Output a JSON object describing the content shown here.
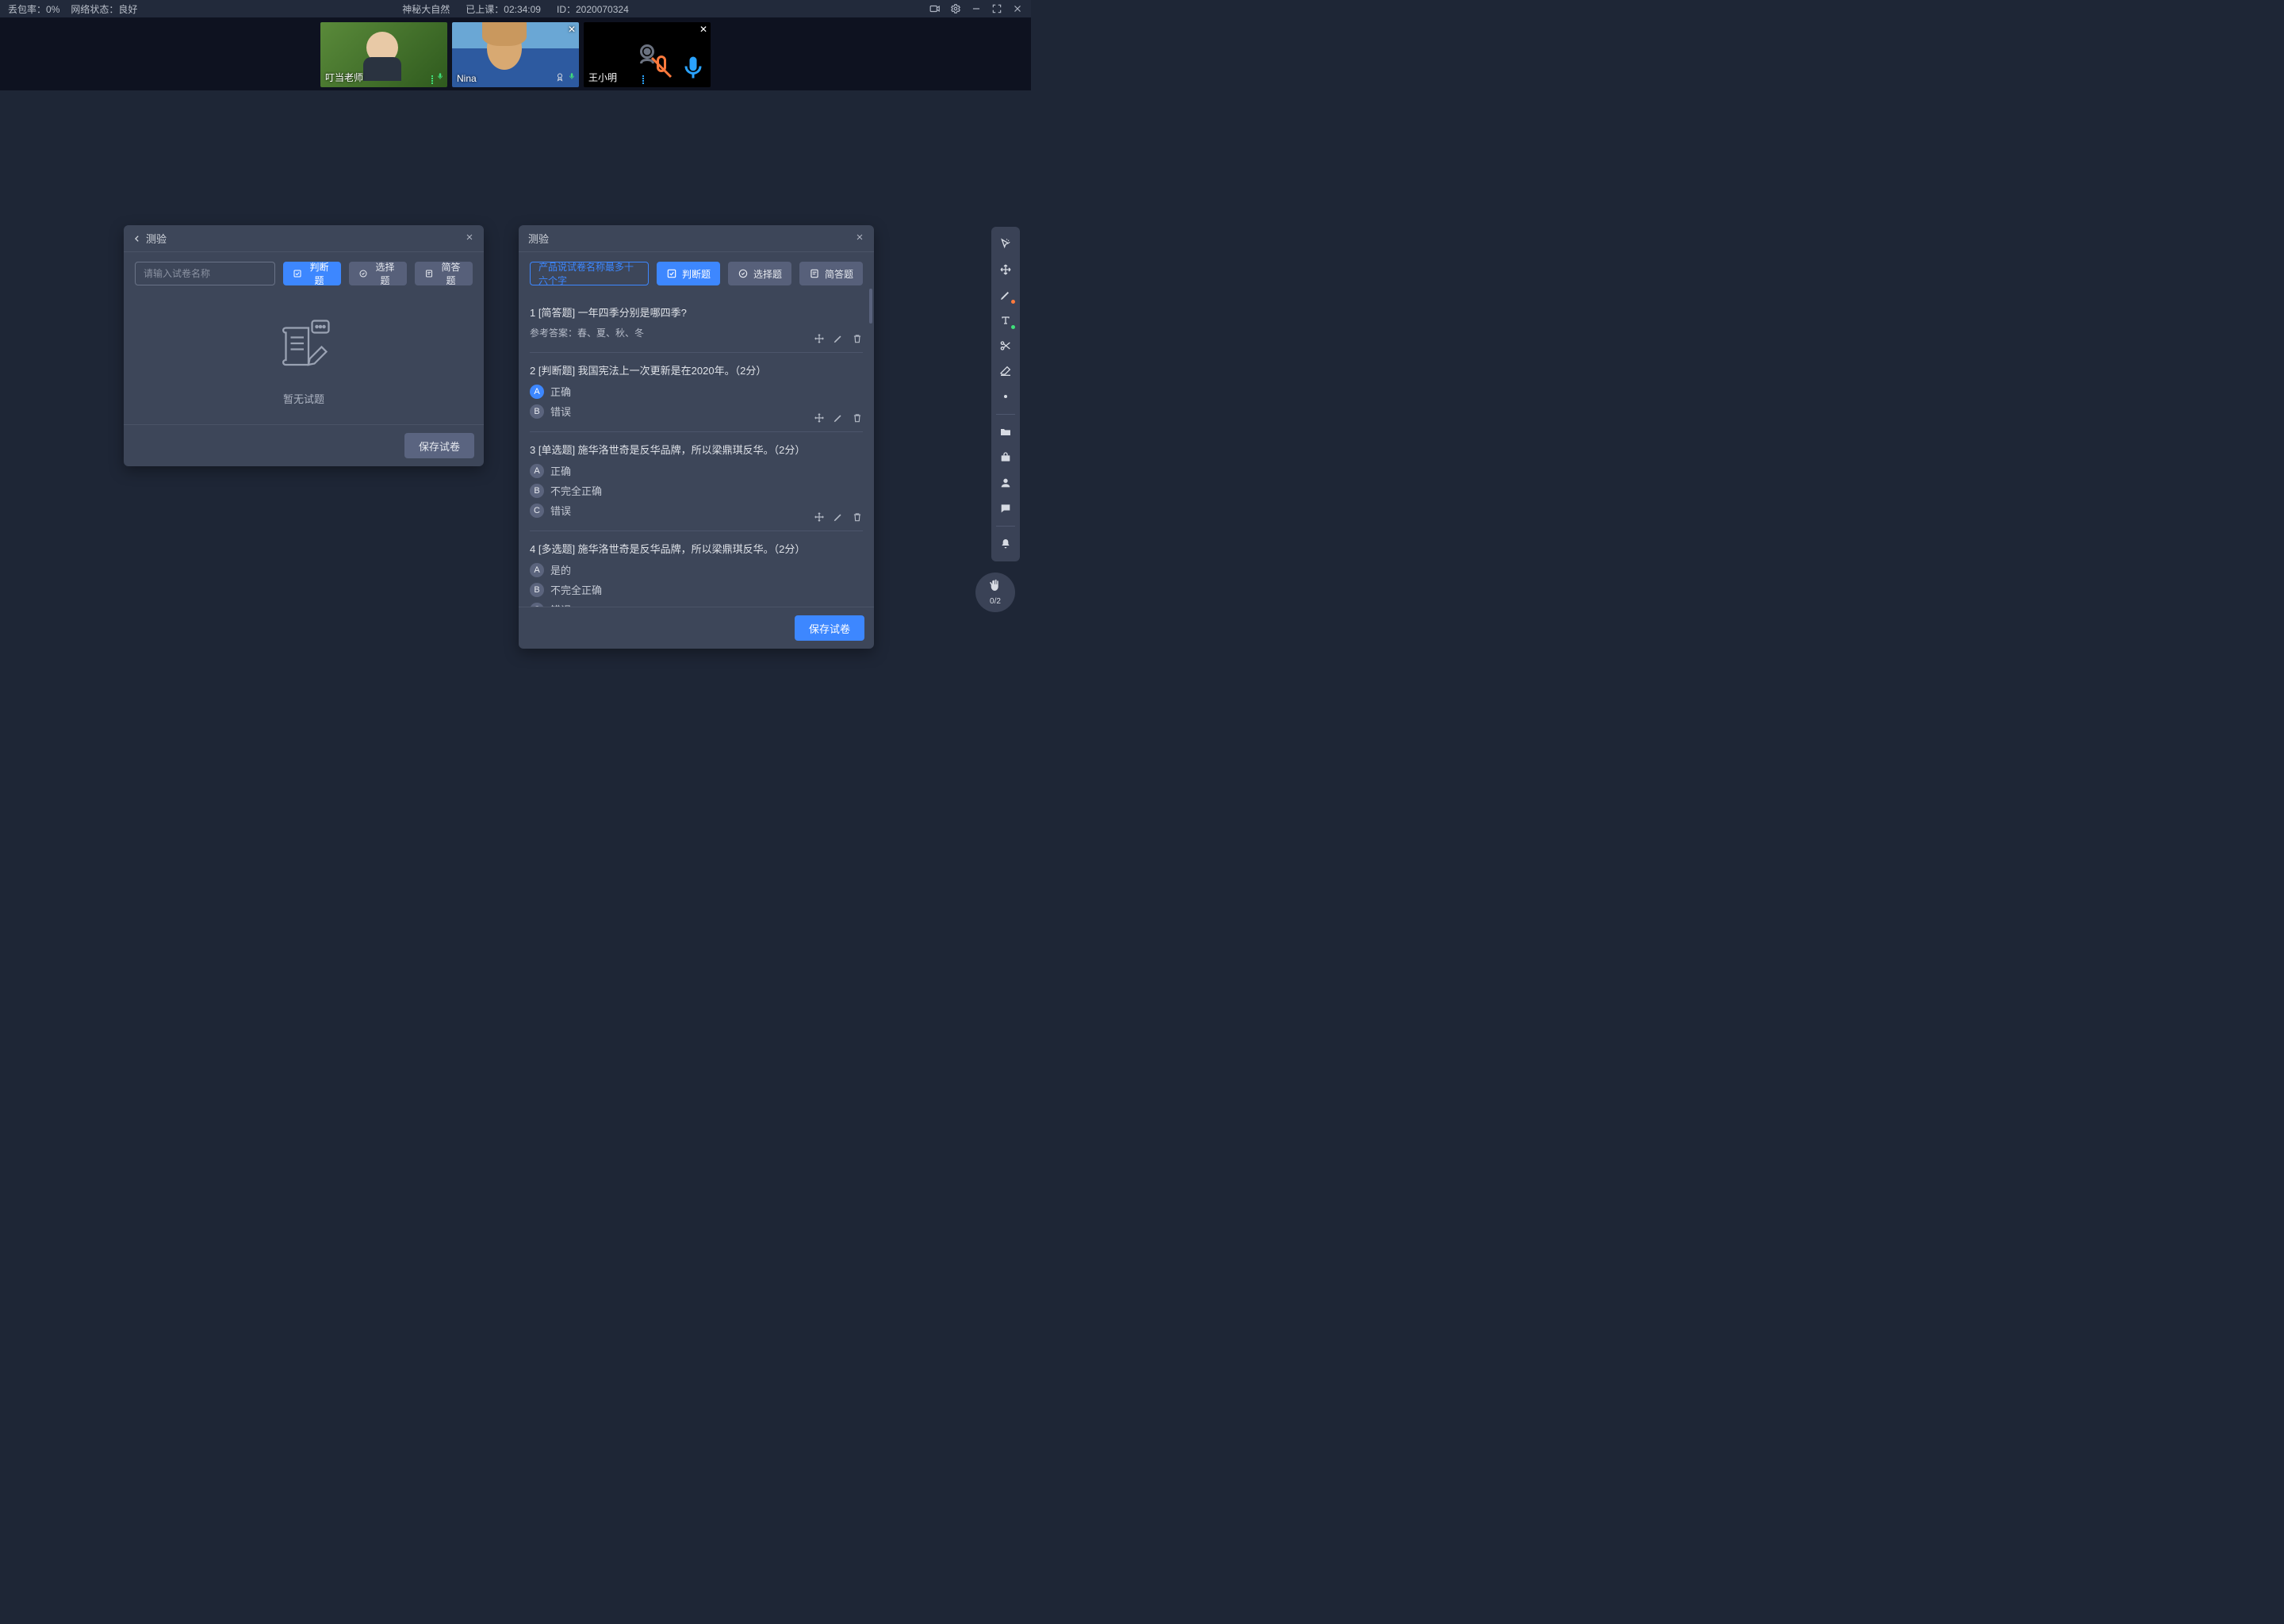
{
  "header": {
    "packet_loss_label": "丢包率：",
    "packet_loss_value": "0%",
    "network_label": "网络状态：",
    "network_value": "良好",
    "title": "神秘大自然",
    "elapsed_label": "已上课：",
    "elapsed_value": "02:34:09",
    "id_label": "ID：",
    "id_value": "2020070324"
  },
  "videos": [
    {
      "name": "叮当老师",
      "has_close": false,
      "camera_on": true
    },
    {
      "name": "Nina",
      "has_close": true,
      "camera_on": true
    },
    {
      "name": "王小明",
      "has_close": true,
      "camera_on": false
    }
  ],
  "panel_left": {
    "title": "测验",
    "input_placeholder": "请输入试卷名称",
    "buttons": {
      "judge": "判断题",
      "choice": "选择题",
      "short": "简答题"
    },
    "empty_text": "暂无试题",
    "save": "保存试卷"
  },
  "panel_right": {
    "title": "测验",
    "input_value": "产品说试卷名称最多十六个字",
    "buttons": {
      "judge": "判断题",
      "choice": "选择题",
      "short": "简答题"
    },
    "save": "保存试卷",
    "ref_prefix": "参考答案：",
    "questions": [
      {
        "num": "1",
        "tag": "[简答题]",
        "text": "一年四季分别是哪四季?",
        "ref_answer": "春、夏、秋、冬",
        "options": []
      },
      {
        "num": "2",
        "tag": "[判断题]",
        "text": "我国宪法上一次更新是在2020年。（2分）",
        "options": [
          {
            "key": "A",
            "label": "正确",
            "selected": true
          },
          {
            "key": "B",
            "label": "错误",
            "selected": false
          }
        ]
      },
      {
        "num": "3",
        "tag": "[单选题]",
        "text": "施华洛世奇是反华品牌，所以梁鼎琪反华。（2分）",
        "options": [
          {
            "key": "A",
            "label": "正确",
            "selected": false
          },
          {
            "key": "B",
            "label": "不完全正确",
            "selected": false
          },
          {
            "key": "C",
            "label": "错误",
            "selected": false
          }
        ]
      },
      {
        "num": "4",
        "tag": "[多选题]",
        "text": "施华洛世奇是反华品牌，所以梁鼎琪反华。（2分）",
        "options": [
          {
            "key": "A",
            "label": "是的",
            "selected": false
          },
          {
            "key": "B",
            "label": "不完全正确",
            "selected": false
          },
          {
            "key": "C",
            "label": "错误",
            "selected": false
          }
        ]
      }
    ]
  },
  "handbadge": {
    "count": "0/2"
  }
}
